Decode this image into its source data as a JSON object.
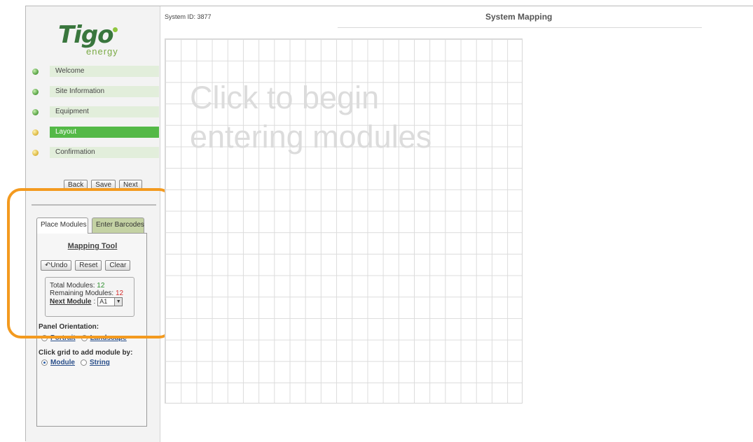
{
  "logo": {
    "brand": "Tigo",
    "tagline": "energy"
  },
  "steps": [
    {
      "label": "Welcome",
      "status": "complete"
    },
    {
      "label": "Site Information",
      "status": "complete"
    },
    {
      "label": "Equipment",
      "status": "complete"
    },
    {
      "label": "Layout",
      "status": "current"
    },
    {
      "label": "Confirmation",
      "status": "pending"
    }
  ],
  "nav": {
    "back": "Back",
    "save": "Save",
    "next": "Next"
  },
  "tabs": {
    "place": "Place Modules",
    "barcodes": "Enter Barcodes"
  },
  "mapping": {
    "title": "Mapping Tool",
    "undo": "Undo",
    "reset": "Reset",
    "clear": "Clear",
    "total_label": "Total Modules:",
    "total_value": "12",
    "remaining_label": "Remaining Modules:",
    "remaining_value": "12",
    "next_label": "Next Module",
    "next_value": "A1"
  },
  "orientation": {
    "label": "Panel Orientation:",
    "portrait": "Portrait",
    "landscape": "Landscape"
  },
  "click_by": {
    "label": "Click grid to add module by:",
    "module": "Module",
    "string": "String",
    "selected": "Module"
  },
  "header": {
    "system_id": "System ID: 3877",
    "title": "System Mapping"
  },
  "grid": {
    "prompt": "Click to begin entering modules"
  },
  "colors": {
    "accent_green": "#54b947",
    "highlight": "#f39a1f",
    "step_bg": "#e2eedb"
  }
}
